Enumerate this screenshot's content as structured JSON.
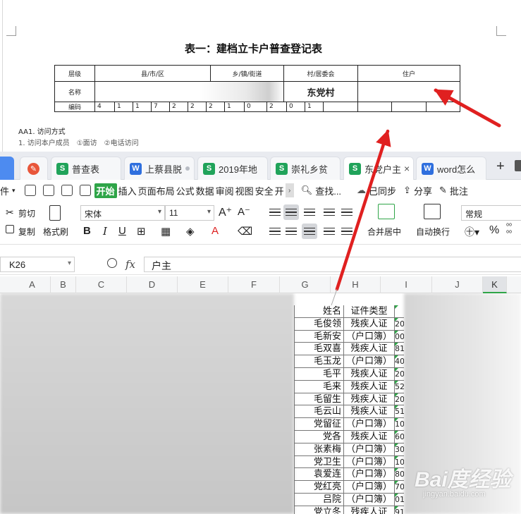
{
  "document": {
    "title_prefix": "表一",
    "title_main": "：建档立卡户普查登记表",
    "table": {
      "row1": [
        "层级",
        "县/市/区",
        "乡/镇/街道",
        "村/居委会",
        "住户"
      ],
      "row2_label": "名称",
      "village_name": "东党村",
      "row3_label": "编码",
      "code_digits": [
        "4",
        "1",
        "1",
        "7",
        "2",
        "2",
        "2",
        "1",
        "0",
        "2",
        "0",
        "1"
      ]
    },
    "line_aa1": "AA1. 访问方式",
    "line_2": "1. 访问本户成员　①面访　②电话访问"
  },
  "tabs": [
    {
      "icon": "s",
      "label": "普查表",
      "active": false,
      "dot": false
    },
    {
      "icon": "w",
      "label": "上蔡县脱",
      "active": false,
      "dot": true
    },
    {
      "icon": "s",
      "label": "2019年地",
      "active": false,
      "dot": false
    },
    {
      "icon": "s",
      "label": "崇礼乡贫",
      "active": false,
      "dot": false
    },
    {
      "icon": "s",
      "label": "东党户主",
      "active": true,
      "dot": false
    },
    {
      "icon": "w",
      "label": "word怎么",
      "active": false,
      "dot": false
    }
  ],
  "menubar": {
    "file": "件",
    "items": [
      "开始",
      "插入",
      "页面布局",
      "公式",
      "数据",
      "审阅",
      "视图",
      "安全",
      "开"
    ],
    "active": "开始",
    "search": "查找...",
    "sync": "已同步",
    "share": "分享",
    "annotate": "批注"
  },
  "ribbon": {
    "cut": "剪切",
    "copy": "复制",
    "format_painter": "格式刷",
    "font": "宋体",
    "font_size": "11",
    "merge": "合并居中",
    "wrap": "自动换行",
    "number_format": "常规",
    "percent": "%"
  },
  "formula_bar": {
    "cell_ref": "K26",
    "fx": "fx",
    "content": "户主"
  },
  "columns": [
    "A",
    "B",
    "C",
    "D",
    "E",
    "F",
    "G",
    "H",
    "I",
    "J",
    "K"
  ],
  "sheet": {
    "header": {
      "name": "姓名",
      "type": "证件类型"
    },
    "rows": [
      {
        "name": "毛俊领",
        "type": "残疾人证",
        "i": "20"
      },
      {
        "name": "毛新安",
        "type": "（户口簿）",
        "i": "00"
      },
      {
        "name": "毛双喜",
        "type": "残疾人证",
        "i": "81"
      },
      {
        "name": "毛玉龙",
        "type": "（户口簿）",
        "i": "40"
      },
      {
        "name": "毛平",
        "type": "残疾人证",
        "i": "20"
      },
      {
        "name": "毛来",
        "type": "残疾人证",
        "i": "52"
      },
      {
        "name": "毛留生",
        "type": "残疾人证",
        "i": "20"
      },
      {
        "name": "毛云山",
        "type": "残疾人证",
        "i": "51"
      },
      {
        "name": "党留征",
        "type": "（户口簿）",
        "i": "10"
      },
      {
        "name": "党各",
        "type": "残疾人证",
        "i": "60"
      },
      {
        "name": "张素梅",
        "type": "（户口簿）",
        "i": "30"
      },
      {
        "name": "党卫生",
        "type": "（户口簿）",
        "i": "10"
      },
      {
        "name": "袁爱连",
        "type": "（户口簿）",
        "i": "80"
      },
      {
        "name": "党红亮",
        "type": "（户口簿）",
        "i": "70"
      },
      {
        "name": "吕院",
        "type": "（户口簿）",
        "i": "01"
      },
      {
        "name": "党立冬",
        "type": "残疾人证",
        "i": "91"
      }
    ]
  },
  "watermark": {
    "logo": "Bai度经验",
    "url": "jingyan.baidu.com"
  },
  "colors": {
    "wps_green": "#2fa548",
    "arrow_red": "#e02020",
    "word_blue": "#2f6fde"
  }
}
